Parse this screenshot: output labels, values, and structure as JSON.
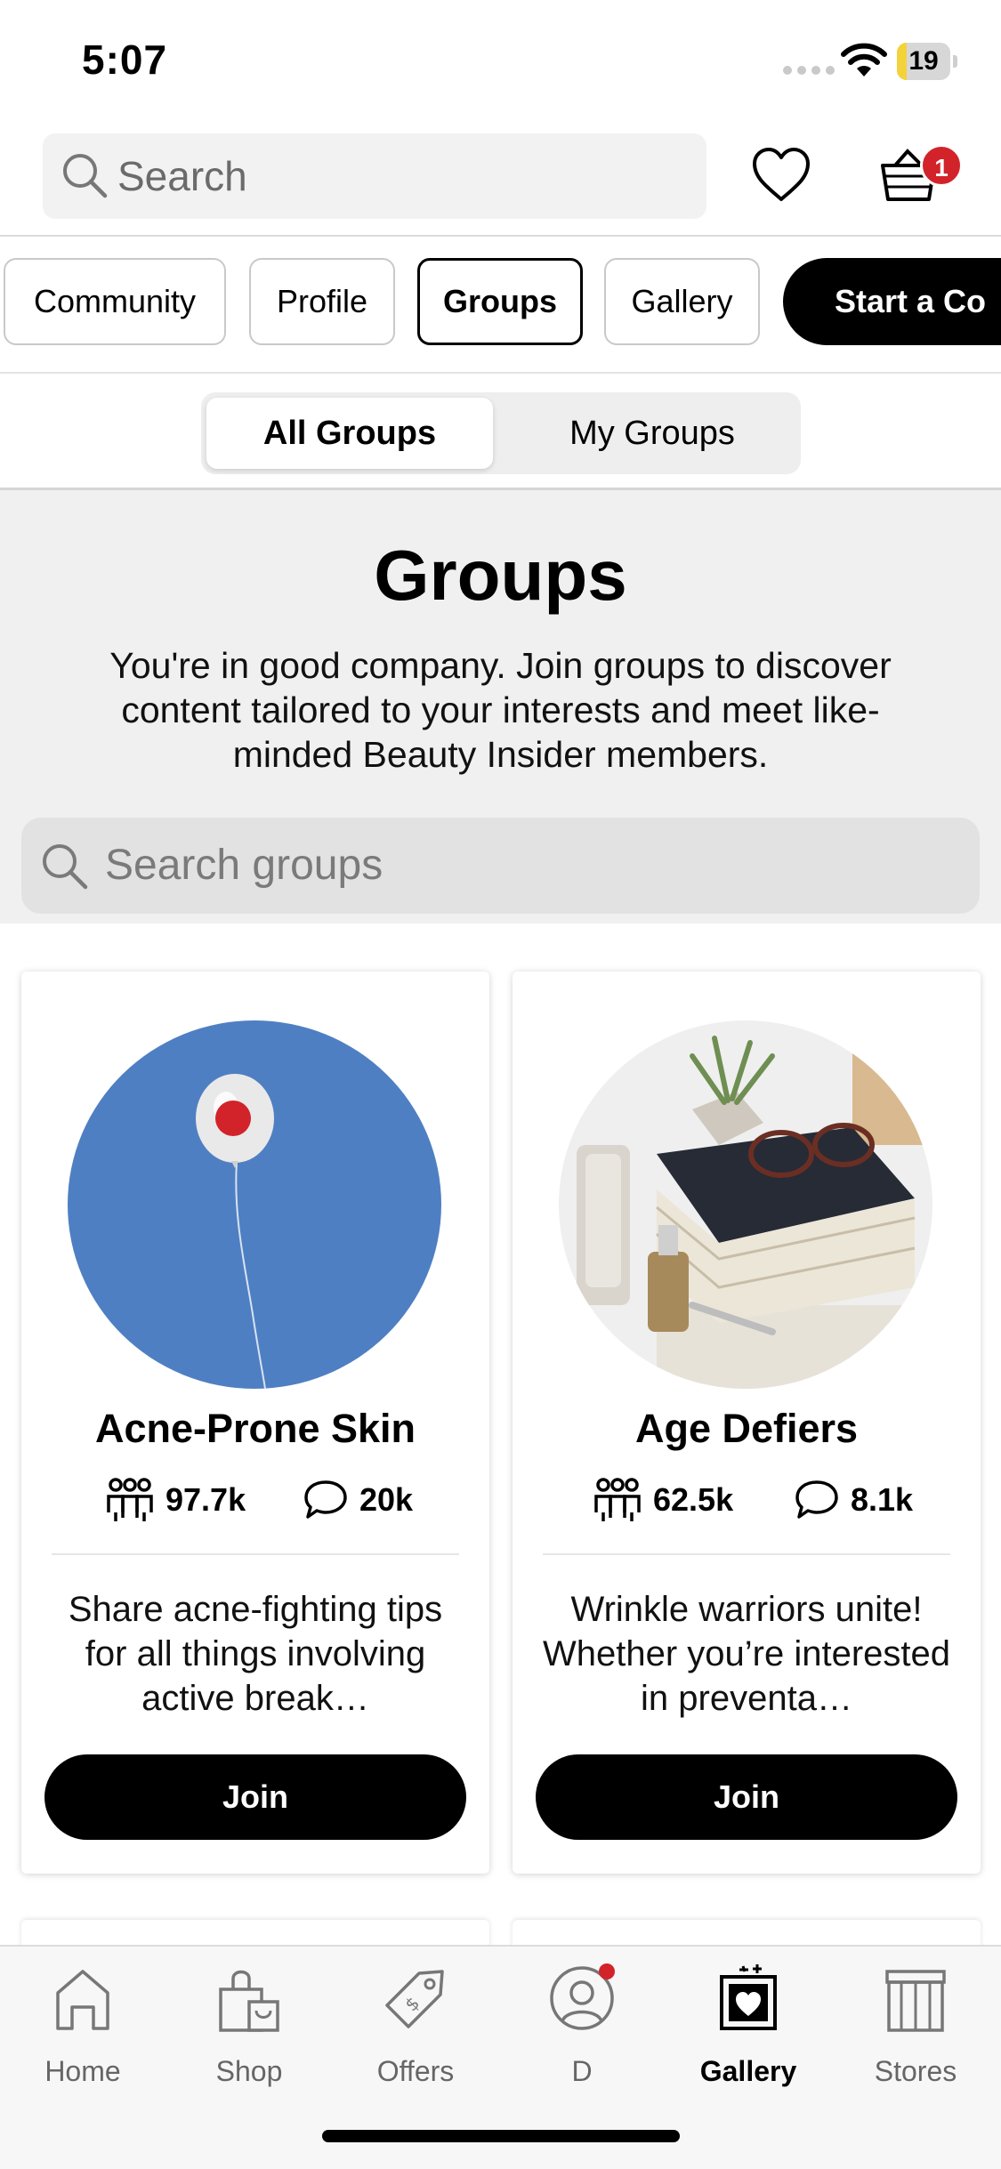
{
  "status_bar": {
    "time": "5:07",
    "battery": "19",
    "battery_level": 0.19
  },
  "header": {
    "search_placeholder": "Search",
    "cart_count": "1"
  },
  "chips": [
    "Community",
    "Profile",
    "Groups",
    "Gallery",
    "Start a Co"
  ],
  "active_chip": "Groups",
  "segmented": {
    "all": "All Groups",
    "mine": "My Groups",
    "selected": "All Groups"
  },
  "intro": {
    "title": "Groups",
    "description": "You're in good company. Join groups to discover content tailored to your interests and meet like-minded Beauty Insider members.",
    "search_placeholder": "Search groups"
  },
  "groups": [
    {
      "name": "Acne-Prone Skin",
      "members": "97.7k",
      "comments": "20k",
      "description": "Share acne-fighting tips for all things involving active break…",
      "join_label": "Join"
    },
    {
      "name": "Age Defiers",
      "members": "62.5k",
      "comments": "8.1k",
      "description": "Wrinkle warriors unite! Whether you’re interested in preventa…",
      "join_label": "Join"
    }
  ],
  "bottom_nav": [
    {
      "label": "Home",
      "icon": "home-icon"
    },
    {
      "label": "Shop",
      "icon": "shopping-bag-icon"
    },
    {
      "label": "Offers",
      "icon": "tag-icon"
    },
    {
      "label": "D",
      "icon": "profile-icon"
    },
    {
      "label": "Gallery",
      "icon": "gallery-icon"
    },
    {
      "label": "Stores",
      "icon": "store-icon"
    }
  ],
  "active_tab": "Gallery",
  "colors": {
    "badge": "#d2232a",
    "primary": "#000000",
    "band": "#f0f0f0",
    "battery": "#f4d23b"
  }
}
